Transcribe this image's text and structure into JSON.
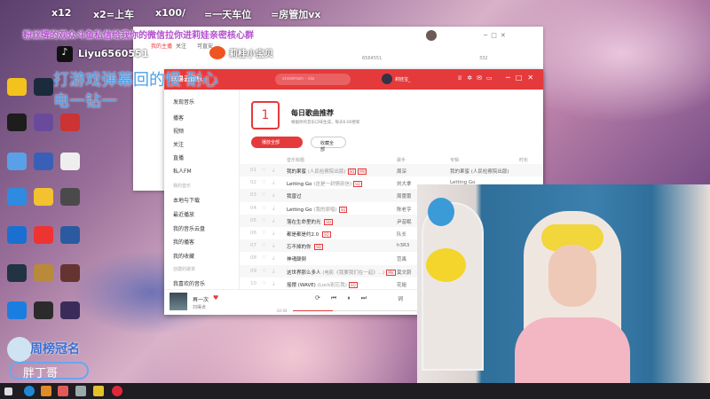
{
  "overlay": {
    "gift_line": [
      "x12",
      "x2=上车",
      "x100/",
      "=一天车位",
      "=房管加vx"
    ],
    "notice": "粉丝牌的观众斗鱼私信给我你的微信拉你进莉娃亲密核心群",
    "douyin": "Liyu6560551",
    "weibo": "莉桂小宝贝",
    "slogan1": "打游戏弹幕回的慢 耐心",
    "slogan2": "电一钻一",
    "weekly_title": "周榜冠名",
    "weekly_name": "胖丁哥"
  },
  "back_window": {
    "tabs": [
      "我的主播",
      "关注",
      "可直安"
    ],
    "room_id": "6564551",
    "count": "332"
  },
  "music": {
    "app_name": "网易云音乐",
    "search_placeholder": "snowman - sia",
    "user": "莉娃宝_",
    "sidebar": {
      "items": [
        "发现音乐",
        "播客",
        "视频",
        "关注",
        "直播",
        "私人FM"
      ],
      "my_music": "我的音乐",
      "my_items": [
        "本地与下载",
        "最近播放",
        "我的音乐云盘",
        "我的播客",
        "我的收藏"
      ],
      "created": "创建的歌单",
      "liked": "我喜欢的音乐"
    },
    "daily": {
      "day": "1",
      "title": "每日歌曲推荐",
      "subtitle": "根据你的音乐口味生成，每天6:00更新",
      "play_all": "播放全部",
      "collect_all": "收藏全部"
    },
    "columns": [
      "音乐标题",
      "歌手",
      "专辑",
      "时长"
    ],
    "songs": [
      {
        "no": "01",
        "title": "我的果蜜",
        "sub": "(人民检察院出版)",
        "tags": [
          "SQ",
          "MV"
        ],
        "artist": "周深",
        "album": "我的果蜜 (人民检察院出版)"
      },
      {
        "no": "02",
        "title": "Letting Go",
        "sub": "(这是一封情别信)",
        "tags": [
          "SQ"
        ],
        "artist": "刘大拿",
        "album": "Letting Go"
      },
      {
        "no": "03",
        "title": "我曾过",
        "sub": "",
        "tags": [],
        "artist": "周蕾蕾",
        "album": ""
      },
      {
        "no": "04",
        "title": "Letting Go",
        "sub": "(我的原唱)",
        "tags": [
          "SQ"
        ],
        "artist": "陈老亨",
        "album": ""
      },
      {
        "no": "05",
        "title": "落在生命里的光",
        "sub": "",
        "tags": [
          "SQ"
        ],
        "artist": "尹昔眠",
        "album": ""
      },
      {
        "no": "06",
        "title": "都是都是约2.0",
        "sub": "",
        "tags": [
          "SQ"
        ],
        "artist": "队长",
        "album": ""
      },
      {
        "no": "07",
        "title": "忘不掉的你",
        "sub": "",
        "tags": [
          "SQ"
        ],
        "artist": "h3R3",
        "album": ""
      },
      {
        "no": "08",
        "title": "神魂颠倒",
        "sub": "",
        "tags": [],
        "artist": "范禹",
        "album": ""
      },
      {
        "no": "09",
        "title": "这世界那么多人",
        "sub": "(电影《我要我们在一起》...)",
        "tags": [
          "MV"
        ],
        "artist": "莫文蔚",
        "album": ""
      },
      {
        "no": "10",
        "title": "摇摆 (WAVE)",
        "sub": "(Lock别忘我)",
        "tags": [
          "SQ"
        ],
        "artist": "花姐",
        "album": ""
      }
    ],
    "player": {
      "title": "再一次",
      "artist": "刘得贞",
      "time": "02:04",
      "lyric_label": "词",
      "progress": 0.32
    }
  },
  "colors": {
    "accent": "#e53a3c"
  }
}
